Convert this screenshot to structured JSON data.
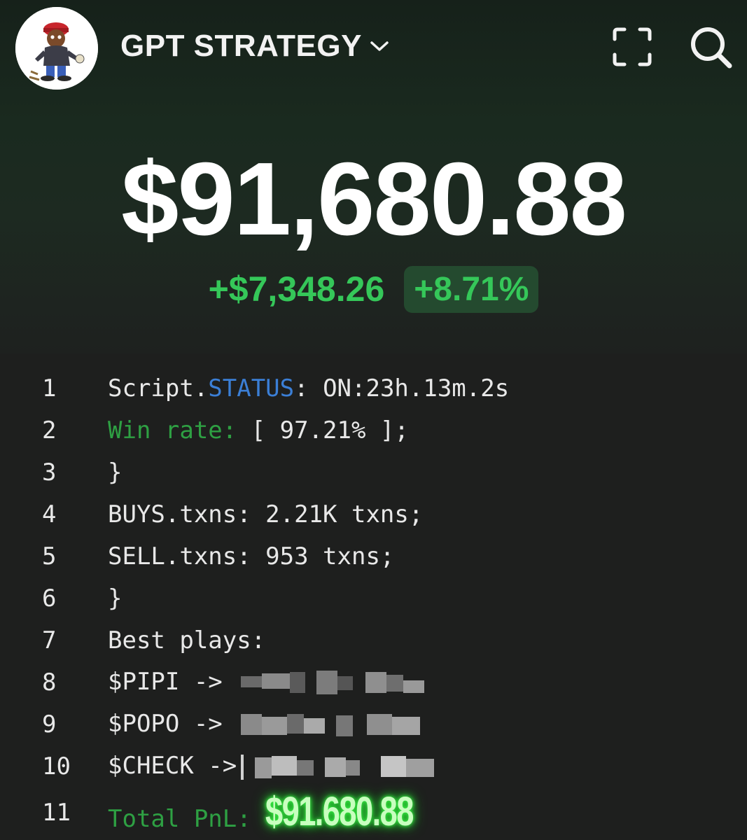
{
  "header": {
    "account_name": "GPT STRATEGY",
    "avatar_icon": "cartoon-avatar-icon",
    "expand_icon": "fullscreen-icon",
    "search_icon": "search-icon"
  },
  "balance": {
    "value": "$91,680.88",
    "change_amount": "+$7,348.26",
    "change_percent": "+8.71%",
    "positive_color": "#35c759"
  },
  "code_lines": [
    {
      "num": "1",
      "parts": [
        "Script.",
        "STATUS",
        ": ON:23h.13m.2s"
      ]
    },
    {
      "num": "2",
      "parts": [
        "Win rate:",
        " [ 97.21% ];"
      ]
    },
    {
      "num": "3",
      "text": "}"
    },
    {
      "num": "4",
      "text": "BUYS.txns: 2.21K txns;"
    },
    {
      "num": "5",
      "text": "SELL.txns: 953 txns;"
    },
    {
      "num": "6",
      "text": "}"
    },
    {
      "num": "7",
      "text": "Best plays:"
    },
    {
      "num": "8",
      "text": "$PIPI -> "
    },
    {
      "num": "9",
      "text": "$POPO -> "
    },
    {
      "num": "10",
      "text": "$CHECK ->"
    },
    {
      "num": "11",
      "parts": [
        "Total PnL: ",
        "$91.680.88"
      ]
    }
  ]
}
